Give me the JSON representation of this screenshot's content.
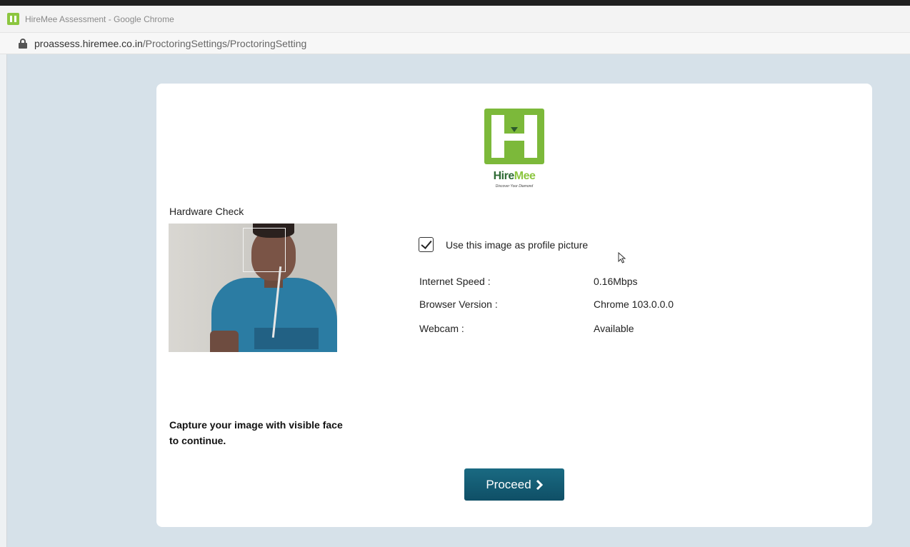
{
  "window": {
    "title": "HireMee Assessment - Google Chrome",
    "url_host": "proassess.hiremee.co.in",
    "url_path": "/ProctoringSettings/ProctoringSetting"
  },
  "logo": {
    "brand_hire": "Hire",
    "brand_mee": "Mee",
    "tagline": "Discover Your Diamond",
    "color_primary": "#7cb93a",
    "color_dark": "#2f6b35"
  },
  "hardware": {
    "title": "Hardware Check",
    "checkbox_label": "Use this image as profile picture",
    "checkbox_checked": true,
    "rows": [
      {
        "label": "Internet Speed :",
        "value": "0.16Mbps"
      },
      {
        "label": "Browser Version :",
        "value": "Chrome 103.0.0.0"
      },
      {
        "label": "Webcam :",
        "value": "Available"
      }
    ]
  },
  "capture_message_line1": "Capture your image with visible face",
  "capture_message_line2": "to continue.",
  "proceed_button": {
    "label": "Proceed",
    "icon": "chevron-right-icon",
    "color": "#12566e"
  }
}
